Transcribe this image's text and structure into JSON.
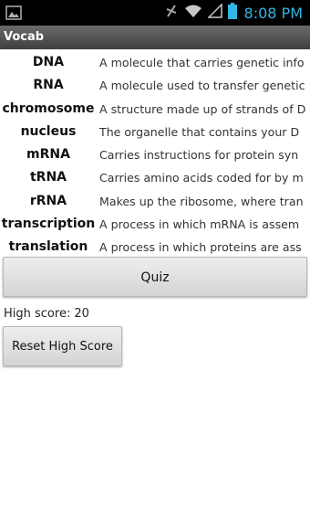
{
  "status_bar": {
    "time": "8:08 PM",
    "icons": [
      "image-icon",
      "signal-off-icon",
      "wifi-icon",
      "cell-signal-icon",
      "battery-icon"
    ],
    "accent_color": "#33b5e5"
  },
  "app": {
    "title": "Vocab"
  },
  "vocab": [
    {
      "term": "DNA",
      "definition": "A molecule that carries genetic info"
    },
    {
      "term": "RNA",
      "definition": "A molecule used to transfer genetic"
    },
    {
      "term": "chromosome",
      "definition": "A structure made up of strands of D"
    },
    {
      "term": "nucleus",
      "definition": "The organelle that contains your D"
    },
    {
      "term": "mRNA",
      "definition": "Carries instructions for protein syn"
    },
    {
      "term": "tRNA",
      "definition": "Carries amino acids coded for by m"
    },
    {
      "term": "rRNA",
      "definition": "Makes up the ribosome, where tran"
    },
    {
      "term": "transcription",
      "definition": "A process in which mRNA is assem"
    },
    {
      "term": "translation",
      "definition": "A process in which proteins are ass"
    }
  ],
  "quiz_button": {
    "label": "Quiz"
  },
  "high_score": {
    "label": "High score:",
    "value": "20"
  },
  "reset_button": {
    "label": "Reset High Score"
  }
}
